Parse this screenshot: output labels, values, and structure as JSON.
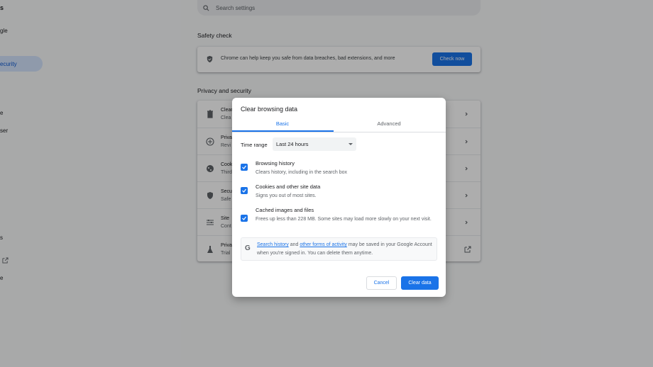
{
  "sidebar": {
    "items": [
      {
        "label": "s"
      },
      {
        "label": "gle"
      },
      {
        "label": "ecurity"
      },
      {
        "label": "e"
      },
      {
        "label": "ser"
      },
      {
        "label": "s"
      },
      {
        "label": "e"
      }
    ]
  },
  "search": {
    "placeholder": "Search settings"
  },
  "safety": {
    "title": "Safety check",
    "text": "Chrome can help keep you safe from data breaches, bad extensions, and more",
    "button": "Check now"
  },
  "privacy": {
    "title": "Privacy and security",
    "rows": [
      {
        "t1": "Clear",
        "t2": "Clea"
      },
      {
        "t1": "Priva",
        "t2": "Revi"
      },
      {
        "t1": "Cook",
        "t2": "Third"
      },
      {
        "t1": "Secu",
        "t2": "Safe"
      },
      {
        "t1": "Site",
        "t2": "Cont"
      },
      {
        "t1": "Priva",
        "t2": "Trial"
      }
    ]
  },
  "dialog": {
    "title": "Clear browsing data",
    "tabs": {
      "basic": "Basic",
      "advanced": "Advanced"
    },
    "time_range_label": "Time range",
    "time_range_value": "Last 24 hours",
    "options": [
      {
        "title": "Browsing history",
        "desc": "Clears history, including in the search box",
        "checked": true
      },
      {
        "title": "Cookies and other site data",
        "desc": "Signs you out of most sites.",
        "checked": true
      },
      {
        "title": "Cached images and files",
        "desc": "Frees up less than 228 MB. Some sites may load more slowly on your next visit.",
        "checked": true
      }
    ],
    "info": {
      "link1": "Search history",
      "and": "and",
      "link2": "other forms of activity",
      "text": "may be saved in your Google Account when you're signed in. You can delete them anytime."
    },
    "cancel": "Cancel",
    "clear": "Clear data"
  },
  "colors": {
    "accent": "#1a73e8",
    "overlay": "rgba(0,0,0,0.32)"
  }
}
